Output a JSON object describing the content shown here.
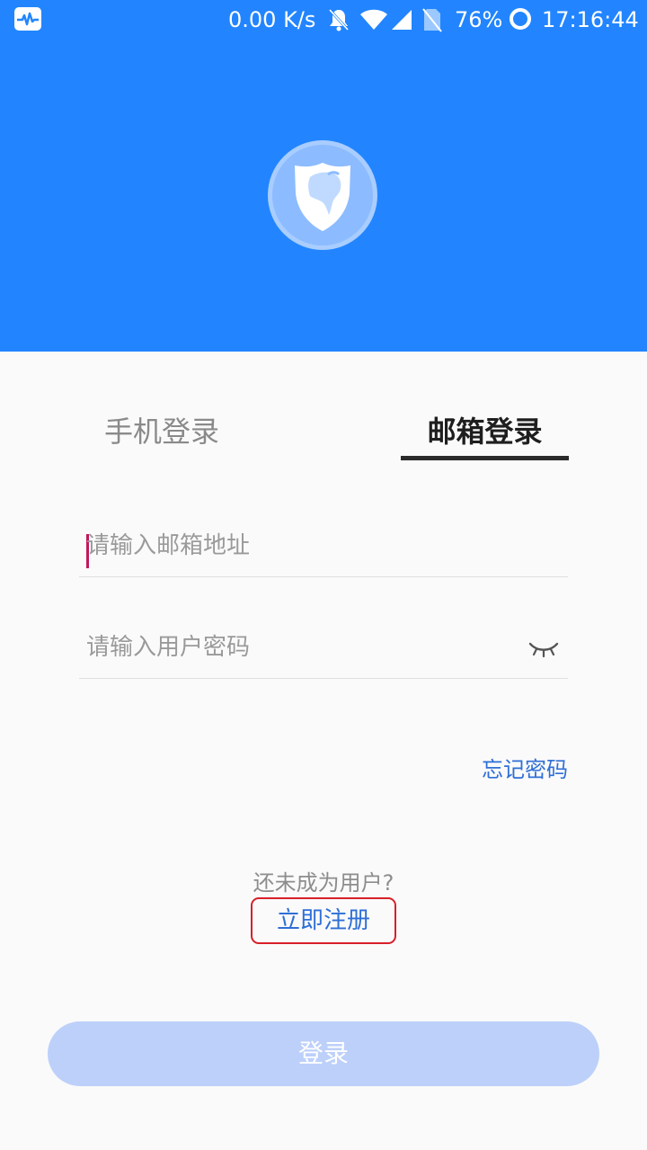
{
  "status_bar": {
    "speed": "0.00 K/s",
    "battery": "76%",
    "time": "17:16:44"
  },
  "tabs": {
    "phone_label": "手机登录",
    "email_label": "邮箱登录",
    "active": "email"
  },
  "form": {
    "email_placeholder": "请输入邮箱地址",
    "email_value": "",
    "password_placeholder": "请输入用户密码",
    "password_value": ""
  },
  "links": {
    "forgot_password": "忘记密码",
    "not_user": "还未成为用户?",
    "register": "立即注册"
  },
  "login_button": "登录",
  "colors": {
    "header": "#2285ff",
    "link": "#2f6fd6",
    "register_border": "#d8202a",
    "login_button": "#bdd0fa"
  },
  "icons": {
    "logo": "horse-shield-icon",
    "password_toggle": "eye-closed-icon"
  }
}
